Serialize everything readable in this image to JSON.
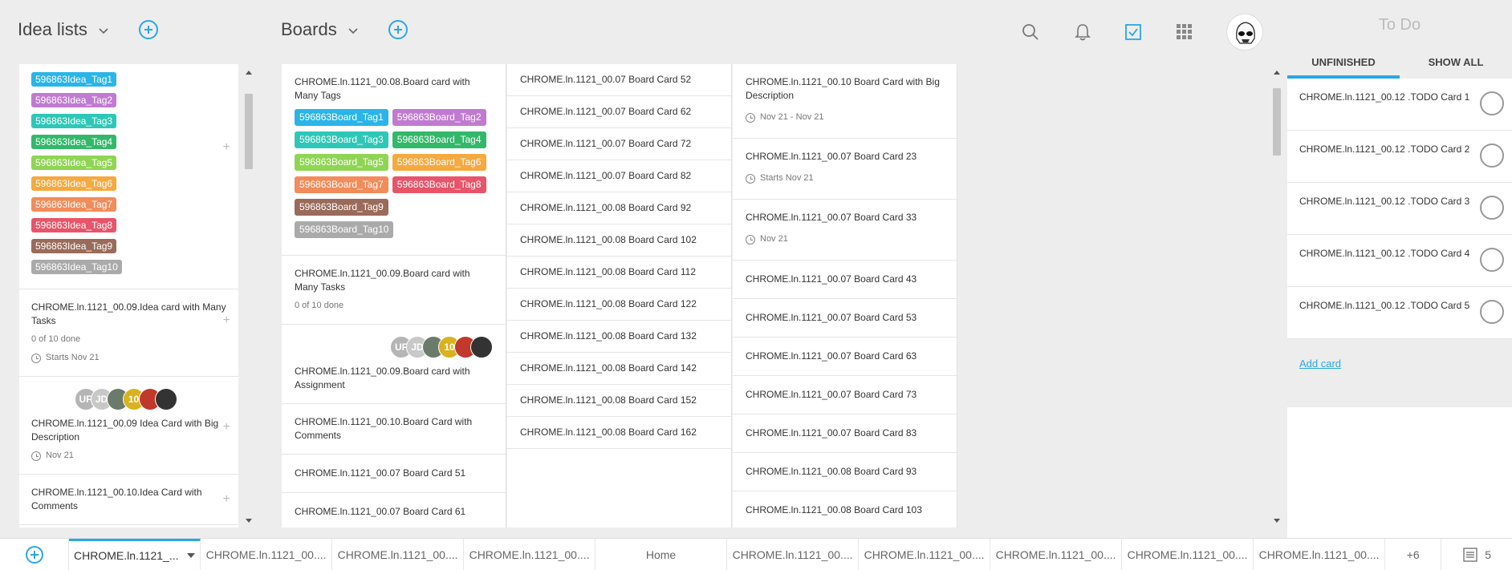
{
  "header": {
    "idea_lists_label": "Idea lists",
    "boards_label": "Boards",
    "icons": [
      "search-icon",
      "bell-icon",
      "checkbox-icon",
      "grid-icon"
    ]
  },
  "idea_tags": [
    {
      "label": "596863Idea_Tag1",
      "color": "#2ab4e8"
    },
    {
      "label": "596863Idea_Tag2",
      "color": "#c07bd1"
    },
    {
      "label": "596863Idea_Tag3",
      "color": "#2ec7b7"
    },
    {
      "label": "596863Idea_Tag4",
      "color": "#33b86a"
    },
    {
      "label": "596863Idea_Tag5",
      "color": "#8fd553"
    },
    {
      "label": "596863Idea_Tag6",
      "color": "#f5a940"
    },
    {
      "label": "596863Idea_Tag7",
      "color": "#f28c5a"
    },
    {
      "label": "596863Idea_Tag8",
      "color": "#e8546a"
    },
    {
      "label": "596863Idea_Tag9",
      "color": "#9a6b5a"
    },
    {
      "label": "596863Idea_Tag10",
      "color": "#aaaaaa"
    }
  ],
  "idea_cards": [
    {
      "title": "CHROME.ln.1121_00.09.Idea card with Many Tasks",
      "sub": "0 of 10 done",
      "meta": "Starts Nov 21"
    },
    {
      "title": "CHROME.ln.1121_00.09 Idea Card with Big Description",
      "meta": "Nov 21"
    },
    {
      "title": "CHROME.ln.1121_00.10.Idea Card with Comments"
    }
  ],
  "avatars": [
    {
      "label": "UF",
      "color": "#b5b5b5"
    },
    {
      "label": "JD",
      "color": "#c8c8c8"
    },
    {
      "label": "",
      "color": "#6b7b6b"
    },
    {
      "label": "10",
      "color": "#d9b21f"
    },
    {
      "label": "",
      "color": "#c0392b"
    },
    {
      "label": "",
      "color": "#333333"
    }
  ],
  "board_col1": {
    "tags_card_title": "CHROME.ln.1121_00.08.Board card with Many Tags",
    "tags": [
      {
        "label": "596863Board_Tag1",
        "color": "#2ab4e8"
      },
      {
        "label": "596863Board_Tag2",
        "color": "#c07bd1"
      },
      {
        "label": "596863Board_Tag3",
        "color": "#2ec7b7"
      },
      {
        "label": "596863Board_Tag4",
        "color": "#33b86a"
      },
      {
        "label": "596863Board_Tag5",
        "color": "#8fd553"
      },
      {
        "label": "596863Board_Tag6",
        "color": "#f5a940"
      },
      {
        "label": "596863Board_Tag7",
        "color": "#f28c5a"
      },
      {
        "label": "596863Board_Tag8",
        "color": "#e8546a"
      },
      {
        "label": "596863Board_Tag9",
        "color": "#9a6b5a"
      },
      {
        "label": "596863Board_Tag10",
        "color": "#aaaaaa"
      }
    ],
    "tasks_card_title": "CHROME.ln.1121_00.09.Board card with Many Tasks",
    "tasks_card_sub": "0 of 10 done",
    "assign_card_title": "CHROME.ln.1121_00.09.Board card with Assignment",
    "comments_card_title": "CHROME.ln.1121_00.10.Board Card with Comments",
    "simple": [
      "CHROME.ln.1121_00.07 Board Card 51",
      "CHROME.ln.1121_00.07 Board Card 61"
    ]
  },
  "board_col2": [
    "CHROME.ln.1121_00.07 Board Card 52",
    "CHROME.ln.1121_00.07 Board Card 62",
    "CHROME.ln.1121_00.07 Board Card 72",
    "CHROME.ln.1121_00.07 Board Card 82",
    "CHROME.ln.1121_00.08 Board Card 92",
    "CHROME.ln.1121_00.08 Board Card 102",
    "CHROME.ln.1121_00.08 Board Card 112",
    "CHROME.ln.1121_00.08 Board Card 122",
    "CHROME.ln.1121_00.08 Board Card 132",
    "CHROME.ln.1121_00.08 Board Card 142",
    "CHROME.ln.1121_00.08 Board Card 152",
    "CHROME.ln.1121_00.08 Board Card 162"
  ],
  "board_col3": {
    "dated": [
      {
        "title": "CHROME.ln.1121_00.10 Board Card with Big Description",
        "meta": "Nov 21 - Nov 21"
      },
      {
        "title": "CHROME.ln.1121_00.07 Board Card 23",
        "meta": "Starts Nov 21"
      },
      {
        "title": "CHROME.ln.1121_00.07 Board Card 33",
        "meta": "Nov 21"
      }
    ],
    "simple": [
      "CHROME.ln.1121_00.07 Board Card 43",
      "CHROME.ln.1121_00.07 Board Card 53",
      "CHROME.ln.1121_00.07 Board Card 63",
      "CHROME.ln.1121_00.07 Board Card 73",
      "CHROME.ln.1121_00.07 Board Card 83",
      "CHROME.ln.1121_00.08 Board Card 93",
      "CHROME.ln.1121_00.08 Board Card 103"
    ]
  },
  "todo_panel": {
    "title": "To Do",
    "tab_unfinished": "UNFINISHED",
    "tab_all": "SHOW ALL",
    "items": [
      "CHROME.ln.1121_00.12 .TODO Card 1",
      "CHROME.ln.1121_00.12 .TODO Card 2",
      "CHROME.ln.1121_00.12 .TODO Card 3",
      "CHROME.ln.1121_00.12 .TODO Card 4",
      "CHROME.ln.1121_00.12 .TODO Card 5"
    ],
    "add_card": "Add card"
  },
  "bottom_tabs": [
    "CHROME.ln.1121_...",
    "CHROME.ln.1121_00....",
    "CHROME.ln.1121_00....",
    "CHROME.ln.1121_00....",
    "Home",
    "CHROME.ln.1121_00....",
    "CHROME.ln.1121_00....",
    "CHROME.ln.1121_00....",
    "CHROME.ln.1121_00....",
    "CHROME.ln.1121_00...."
  ],
  "bottom_more": "+6",
  "bottom_count": "5"
}
